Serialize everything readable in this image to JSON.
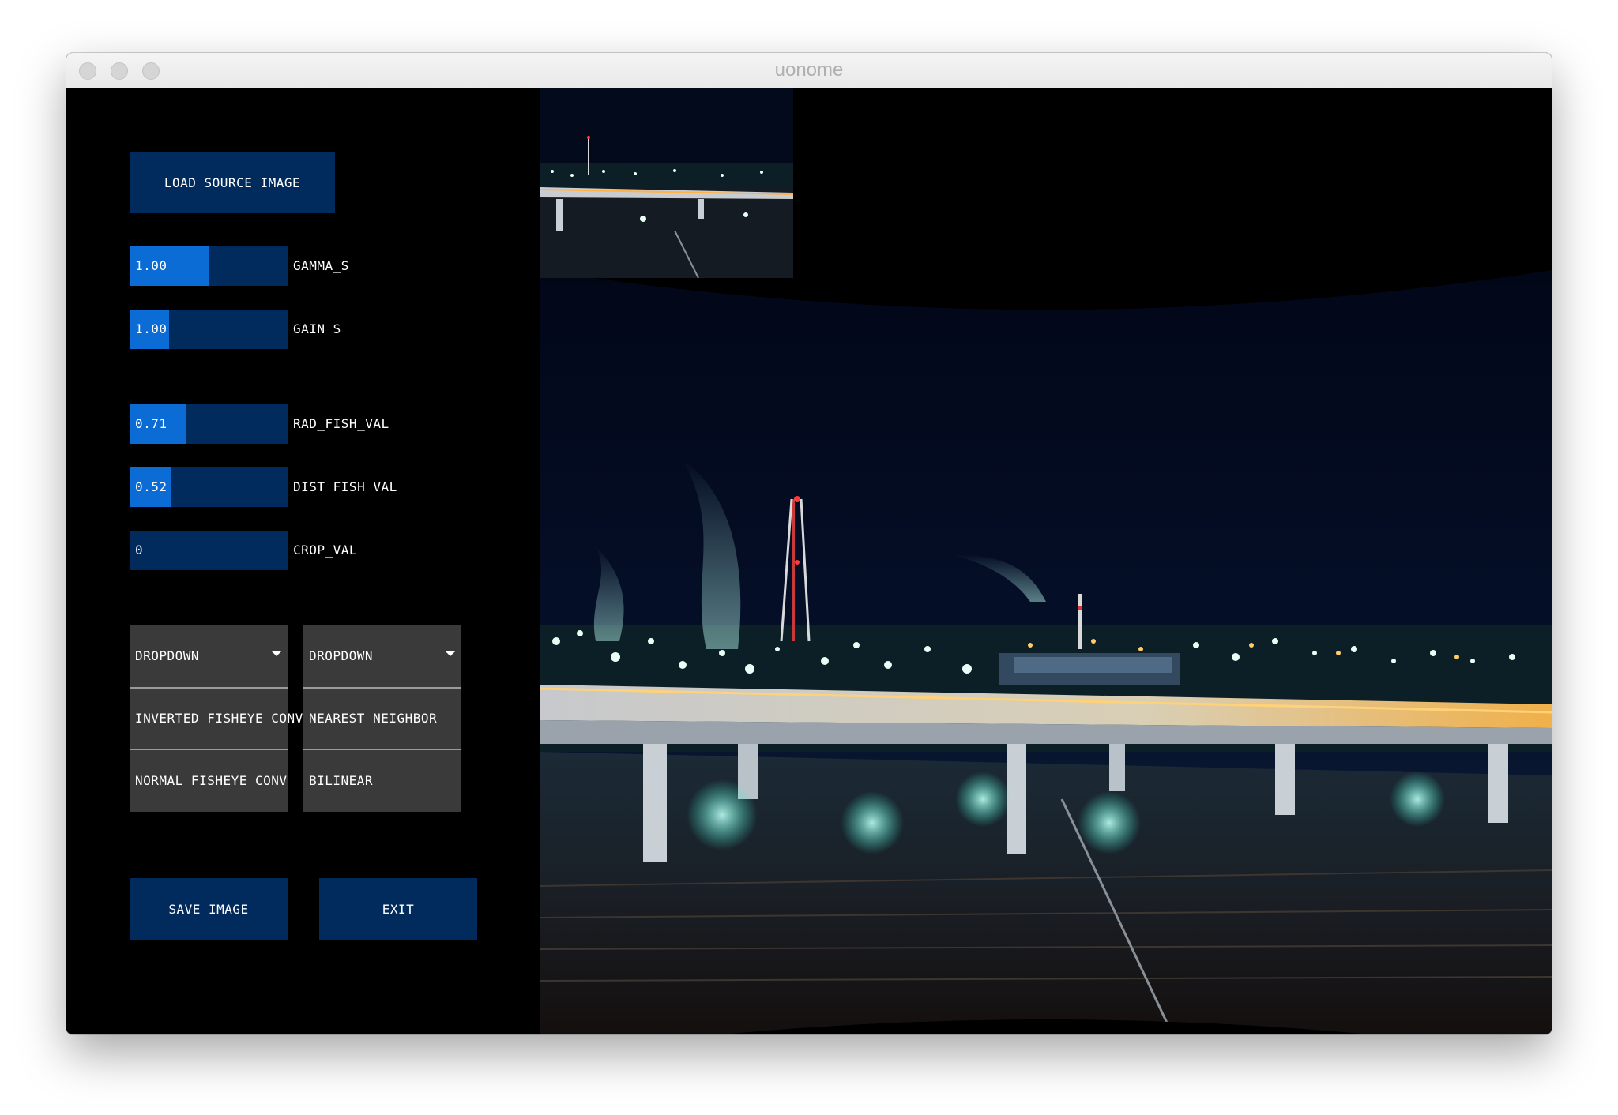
{
  "window": {
    "title": "uonome"
  },
  "controls": {
    "load_button": "LOAD SOURCE IMAGE",
    "sliders": [
      {
        "label": "GAMMA_S",
        "value_text": "1.00",
        "fill_fraction": 0.5
      },
      {
        "label": "GAIN_S",
        "value_text": "1.00",
        "fill_fraction": 0.25
      },
      {
        "label": "RAD_FISH_VAL",
        "value_text": "0.71",
        "fill_fraction": 0.36
      },
      {
        "label": "DIST_FISH_VAL",
        "value_text": "0.52",
        "fill_fraction": 0.26
      },
      {
        "label": "CROP_VAL",
        "value_text": "0",
        "fill_fraction": 0.0
      }
    ],
    "dropdown_left": {
      "label": "DROPDOWN",
      "options": [
        "INVERTED FISHEYE CONV",
        "NORMAL FISHEYE CONV"
      ]
    },
    "dropdown_right": {
      "label": "DROPDOWN",
      "options": [
        "NEAREST NEIGHBOR",
        "BILINEAR"
      ]
    },
    "save_button": "SAVE IMAGE",
    "exit_button": "EXIT"
  },
  "colors": {
    "button_bg": "#012b5d",
    "slider_fill": "#0a6cd4",
    "dropdown_bg": "#3a3a3a",
    "canvas_bg": "#000000"
  },
  "icons": {
    "dropdown_caret": "caret-down-icon"
  }
}
